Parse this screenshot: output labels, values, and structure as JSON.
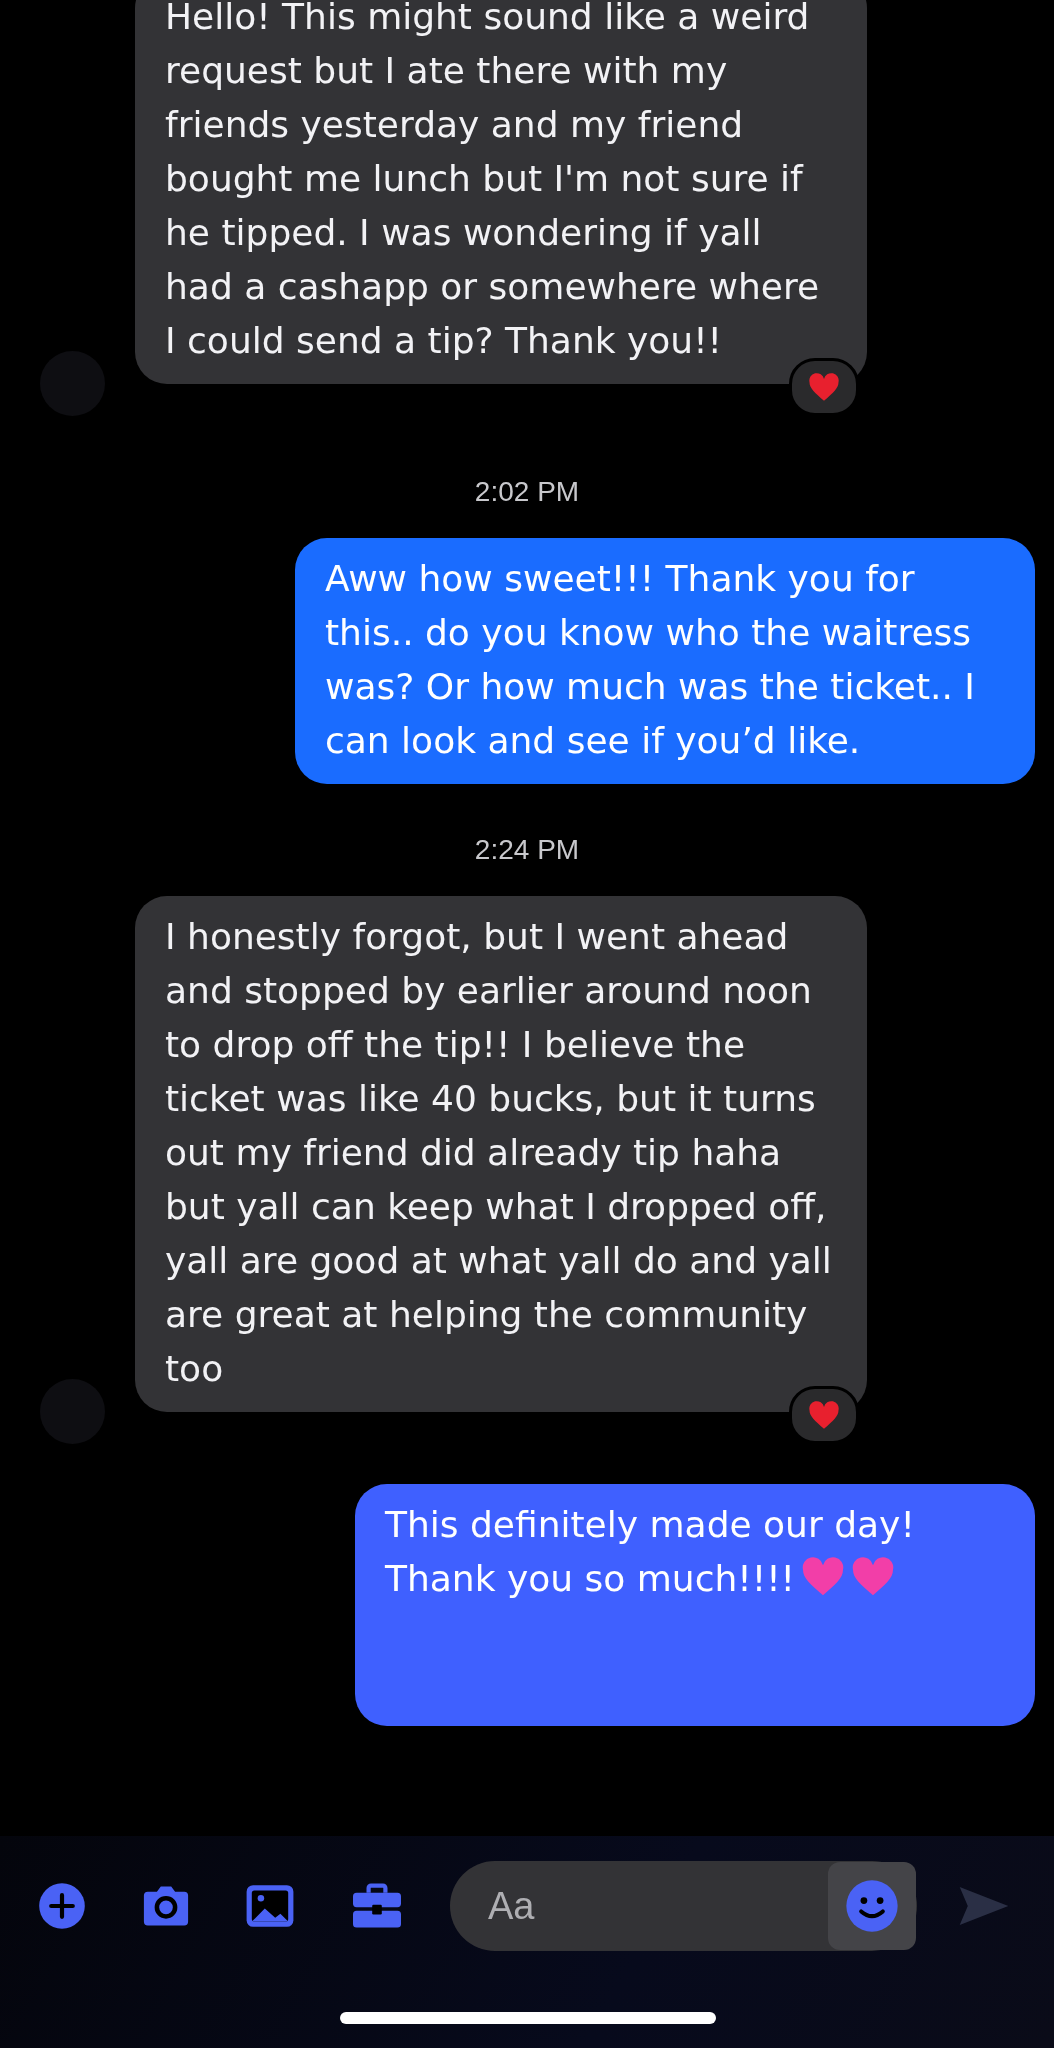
{
  "messages": [
    {
      "kind": "incoming",
      "text": "Hello! This might sound like a weird request but I ate there with my friends yesterday and my friend bought me lunch but I'm not sure if he tipped. I was wondering if yall had a cashapp or somewhere where I could send a tip? Thank you!!",
      "reacted": true,
      "avatar": true
    },
    {
      "kind": "timestamp",
      "text": "2:02 PM"
    },
    {
      "kind": "outgoing",
      "text": "Aww how sweet!!! Thank you for this.. do you know who the waitress was? Or how much was the ticket.. I can look and see if you’d like."
    },
    {
      "kind": "timestamp",
      "text": "2:24 PM"
    },
    {
      "kind": "incoming",
      "text": "I honestly forgot, but I went ahead and stopped by earlier around noon to drop off the tip!! I believe the ticket was like 40 bucks, but it turns out my friend did already tip haha but yall can keep what I dropped off, yall are good at what yall do and yall are great at helping the community too",
      "reacted": true,
      "avatar": true
    },
    {
      "kind": "outgoing",
      "text": "This definitely made our day! Thank you so much!!!!",
      "trailing_icons": [
        {
          "kind": "heart"
        },
        {
          "kind": "heart"
        }
      ]
    }
  ],
  "composer": {
    "placeholder": "Aa"
  }
}
